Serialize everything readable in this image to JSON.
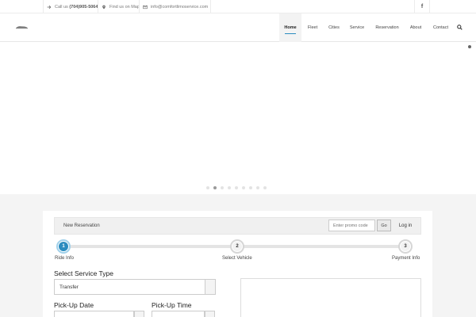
{
  "topbar": {
    "call_label": "Call us",
    "phone": "(704)905-5064",
    "map_label": "Find us on Map",
    "email": "info@comfortlimoservice.com",
    "social": "f"
  },
  "nav": {
    "items": [
      "Home",
      "Fleet",
      "Cities",
      "Service",
      "Reservation",
      "About",
      "Contact"
    ],
    "active": "Home"
  },
  "slider": {
    "dot_count": 9,
    "active_dot": 2
  },
  "reservation": {
    "title": "New Reservation",
    "promo_placeholder": "Enter promo code",
    "go_label": "Go",
    "login_label": "Log in"
  },
  "steps": [
    {
      "number": "1",
      "label": "Ride Info",
      "active": true
    },
    {
      "number": "2",
      "label": "Select Vehicle",
      "active": false
    },
    {
      "number": "3",
      "label": "Payment Info",
      "active": false
    }
  ],
  "form": {
    "service_type_heading": "Select Service Type",
    "service_type_value": "Transfer",
    "pickup_date_heading": "Pick-Up Date",
    "pickup_time_heading": "Pick-Up Time"
  },
  "colors": {
    "accent": "#2b8cbf",
    "section_bg": "#f4f4f4"
  }
}
